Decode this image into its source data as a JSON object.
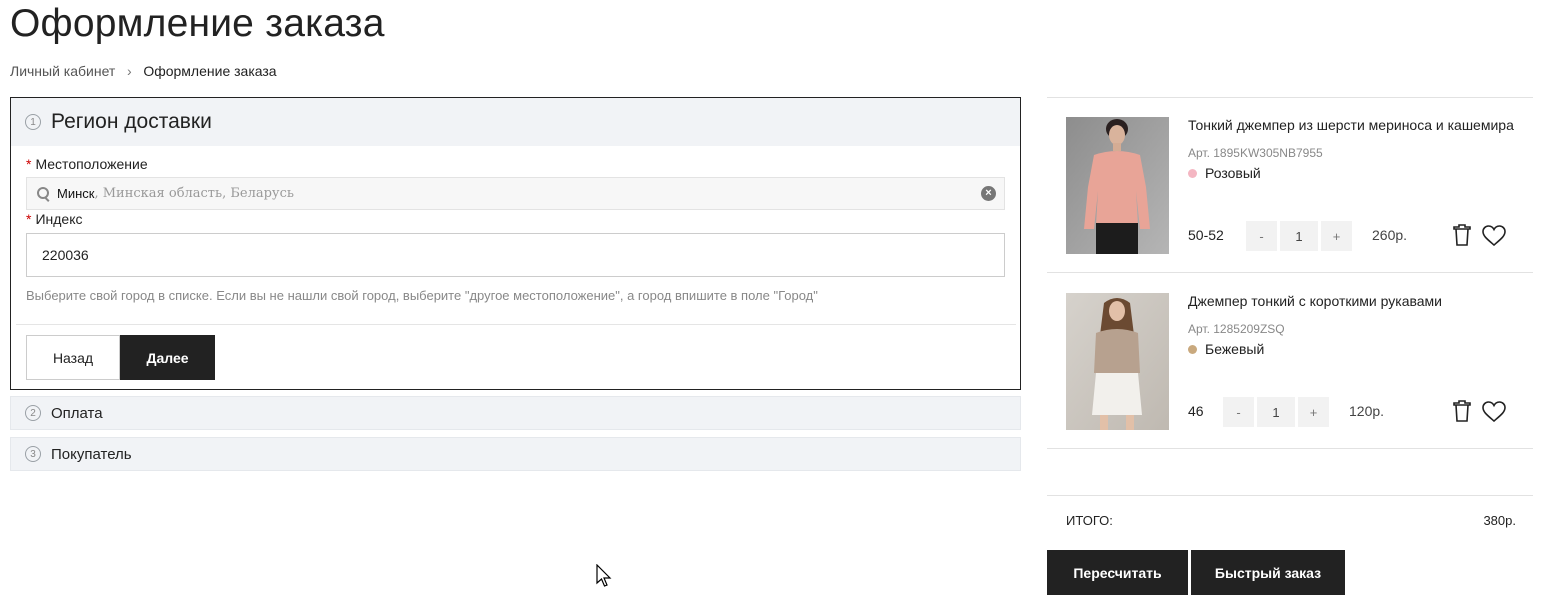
{
  "page": {
    "title": "Оформление заказа"
  },
  "breadcrumb": {
    "items": [
      "Личный кабинет",
      "Оформление заказа"
    ],
    "separator": "›"
  },
  "checkout": {
    "delivery": {
      "step": "1",
      "title": "Регион доставки",
      "location_label": "Местоположение",
      "location_city": "Минск",
      "location_rest": ", Минская область, Беларусь",
      "index_label": "Индекс",
      "index_value": "220036",
      "required_mark": "*",
      "hint": "Выберите свой город в списке. Если вы не нашли свой город, выберите \"другое местоположение\", а город впишите в поле \"Город\"",
      "back_label": "Назад",
      "next_label": "Далее"
    },
    "payment": {
      "step": "2",
      "title": "Оплата"
    },
    "buyer": {
      "step": "3",
      "title": "Покупатель"
    }
  },
  "cart": {
    "items": [
      {
        "name": "Тонкий джемпер из шерсти мериноса и кашемира",
        "sku": "Арт. 1895KW305NB7955",
        "color": "Розовый",
        "color_hex": "#f4b6c2",
        "size": "50-52",
        "qty": "1",
        "price": "260р."
      },
      {
        "name": "Джемпер тонкий с короткими рукавами",
        "sku": "Арт. 1285209ZSQ",
        "color": "Бежевый",
        "color_hex": "#c9a97e",
        "size": "46",
        "qty": "1",
        "price": "120р."
      }
    ],
    "qty_minus": "-",
    "qty_plus": "+",
    "total_label": "ИТОГО:",
    "total_value": "380р.",
    "recalc_label": "Пересчитать",
    "quick_order_label": "Быстрый заказ"
  },
  "colors": {
    "dark_button": "#222222",
    "section_bg": "#f1f3f6",
    "required": "#cc0000"
  }
}
